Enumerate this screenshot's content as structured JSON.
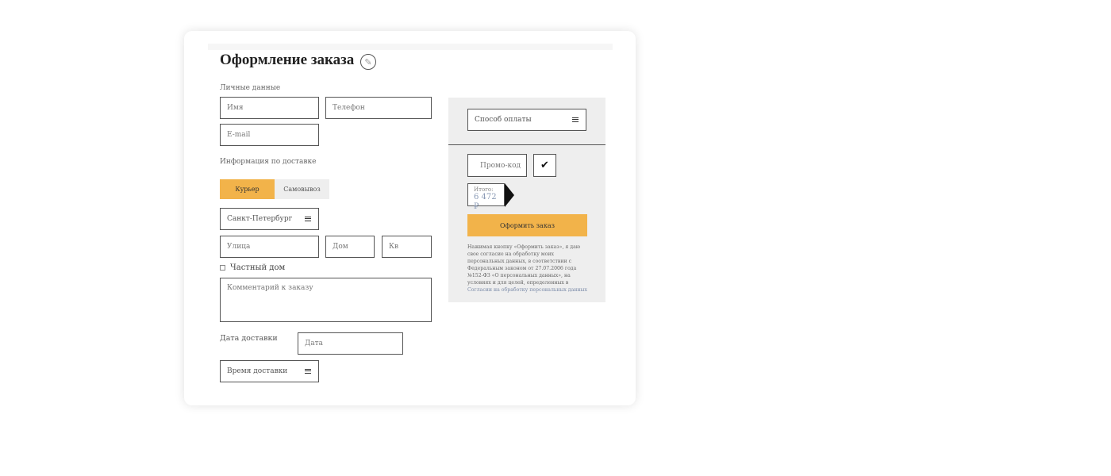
{
  "form": {
    "title": "Оформление заказа",
    "title_icon": "edit-icon",
    "personal_label": "Личные данные",
    "name_placeholder": "Имя",
    "phone_placeholder": "Телефон",
    "email_placeholder": "E-mail",
    "delivery_label": "Информация по доставке",
    "tabs": [
      {
        "label": "Курьер",
        "active": true
      },
      {
        "label": "Самовывоз",
        "active": false
      }
    ],
    "city_value": "Санкт-Петербург",
    "street_placeholder": "Улица",
    "house_placeholder": "Дом",
    "apt_placeholder": "Кв",
    "private_house_label": "Частный дом",
    "comment_placeholder": "Комментарий к заказу",
    "delivery_date_label": "Дата доставки",
    "date_placeholder": "Дата",
    "delivery_time_value": "Время доставки"
  },
  "summary": {
    "payment_value": "Способ оплаты",
    "promo_placeholder": "Промо-код",
    "total_label": "Итого:",
    "total_value": "6 472 ₽",
    "submit_label": "Оформить заказ",
    "legal_text": "Нажимая кнопку «Оформить заказ», я даю свое согласие на обработку моих персональных данных, в соответствии с Федеральным законом от 27.07.2006 года №152-ФЗ «О персональных данных», на условиях и для целей, определенных в ",
    "legal_link": "Согласии на обработку персональных данных"
  },
  "colors": {
    "accent": "#f2b34a",
    "panel_bg": "#eeeeee"
  }
}
